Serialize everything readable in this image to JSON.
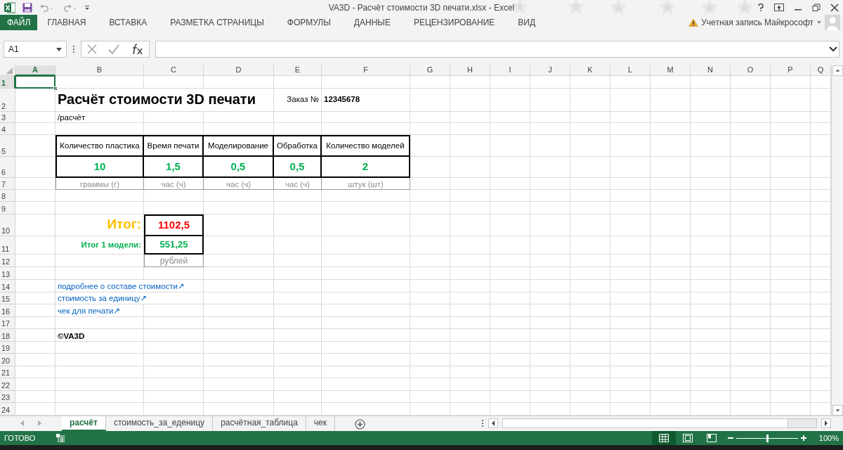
{
  "window": {
    "title": "VA3D - Расчёт стоимости 3D печати.xlsx - Excel"
  },
  "ribbon": {
    "tabs": [
      {
        "label": "ФАЙЛ",
        "kind": "file"
      },
      {
        "label": "ГЛАВНАЯ",
        "kind": "tab"
      },
      {
        "label": "ВСТАВКА",
        "kind": "tab"
      },
      {
        "label": "РАЗМЕТКА СТРАНИЦЫ",
        "kind": "tab"
      },
      {
        "label": "ФОРМУЛЫ",
        "kind": "tab"
      },
      {
        "label": "ДАННЫЕ",
        "kind": "tab"
      },
      {
        "label": "РЕЦЕНЗИРОВАНИЕ",
        "kind": "tab"
      },
      {
        "label": "ВИД",
        "kind": "tab"
      }
    ],
    "account": "Учетная запись Майкрософт"
  },
  "formula_bar": {
    "name_box": "A1"
  },
  "sheet": {
    "columns": [
      {
        "label": "A",
        "selected": true
      },
      {
        "label": "B",
        "selected": false
      },
      {
        "label": "C",
        "selected": false
      },
      {
        "label": "D",
        "selected": false
      },
      {
        "label": "E",
        "selected": false
      },
      {
        "label": "F",
        "selected": false
      },
      {
        "label": "G",
        "selected": false
      },
      {
        "label": "H",
        "selected": false
      },
      {
        "label": "I",
        "selected": false
      },
      {
        "label": "J",
        "selected": false
      },
      {
        "label": "K",
        "selected": false
      },
      {
        "label": "L",
        "selected": false
      },
      {
        "label": "M",
        "selected": false
      },
      {
        "label": "N",
        "selected": false
      },
      {
        "label": "O",
        "selected": false
      },
      {
        "label": "P",
        "selected": false
      },
      {
        "label": "Q",
        "selected": false
      }
    ],
    "rows": [
      {
        "label": "1",
        "selected": true
      },
      {
        "label": "2",
        "selected": false
      },
      {
        "label": "3",
        "selected": false
      },
      {
        "label": "4",
        "selected": false
      },
      {
        "label": "5",
        "selected": false
      },
      {
        "label": "6",
        "selected": false
      },
      {
        "label": "7",
        "selected": false
      },
      {
        "label": "8",
        "selected": false
      },
      {
        "label": "9",
        "selected": false
      },
      {
        "label": "10",
        "selected": false
      },
      {
        "label": "11",
        "selected": false
      },
      {
        "label": "12",
        "selected": false
      },
      {
        "label": "13",
        "selected": false
      },
      {
        "label": "14",
        "selected": false
      },
      {
        "label": "15",
        "selected": false
      },
      {
        "label": "16",
        "selected": false
      },
      {
        "label": "17",
        "selected": false
      },
      {
        "label": "18",
        "selected": false
      },
      {
        "label": "19",
        "selected": false
      },
      {
        "label": "20",
        "selected": false
      },
      {
        "label": "21",
        "selected": false
      },
      {
        "label": "22",
        "selected": false
      },
      {
        "label": "23",
        "selected": false
      },
      {
        "label": "24",
        "selected": false
      }
    ],
    "title": "Расчёт стоимости 3D печати",
    "subtitle": "/расчёт",
    "order_label": "Заказ №",
    "order_number": "12345678",
    "params": [
      {
        "header": "Количество пластика",
        "value": "10",
        "unit": "граммы (г)"
      },
      {
        "header": "Время печати",
        "value": "1,5",
        "unit": "час (ч)"
      },
      {
        "header": "Моделирование",
        "value": "0,5",
        "unit": "час (ч)"
      },
      {
        "header": "Обработка",
        "value": "0,5",
        "unit": "час (ч)"
      },
      {
        "header": "Количество моделей",
        "value": "2",
        "unit": "штук (шт)"
      }
    ],
    "total_label": "Итог:",
    "total": "1102,5",
    "model_total_label": "Итог 1 модели:",
    "model_total": "551,25",
    "currency": "рублей",
    "links": [
      "подробнее о составе стоимости↗",
      "стоимость за единицу↗",
      "чек для печати↗"
    ],
    "copyright": "©VA3D"
  },
  "sheet_tabs": [
    {
      "label": "расчёт",
      "selected": true
    },
    {
      "label": "стоимость_за_еденицу",
      "selected": false
    },
    {
      "label": "расчётная_таблица",
      "selected": false
    },
    {
      "label": "чек",
      "selected": false
    }
  ],
  "status_bar": {
    "status": "ГОТОВО",
    "views": [
      {
        "kind": "normal",
        "selected": true
      },
      {
        "kind": "page_layout",
        "selected": false
      },
      {
        "kind": "page_break",
        "selected": false
      }
    ],
    "zoom": {
      "level": 0.5,
      "reading": "100%"
    }
  }
}
